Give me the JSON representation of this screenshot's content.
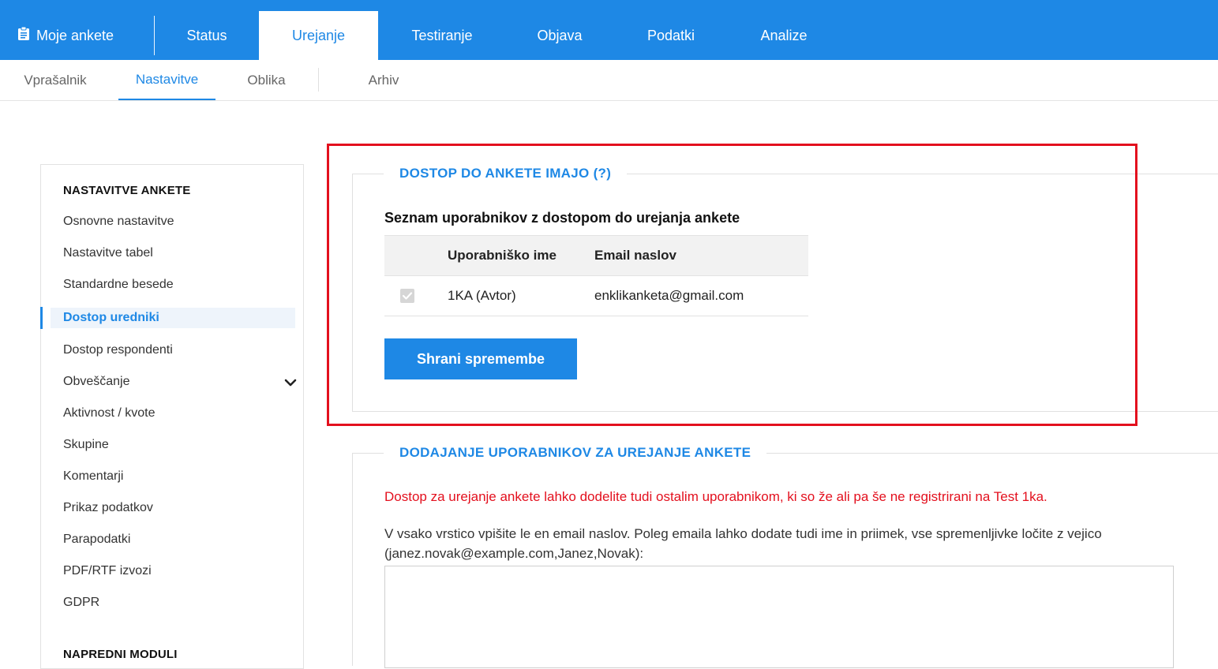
{
  "topnav": {
    "my_surveys": "Moje ankete",
    "items": [
      "Status",
      "Urejanje",
      "Testiranje",
      "Objava",
      "Podatki",
      "Analize"
    ],
    "active": "Urejanje"
  },
  "subnav": {
    "items": [
      "Vprašalnik",
      "Nastavitve",
      "Oblika",
      "Arhiv"
    ],
    "active": "Nastavitve"
  },
  "sidebar": {
    "heading": "NASTAVITVE ANKETE",
    "links": [
      "Osnovne nastavitve",
      "Nastavitve tabel",
      "Standardne besede",
      "Dostop uredniki",
      "Dostop respondenti",
      "Obveščanje",
      "Aktivnost / kvote",
      "Skupine",
      "Komentarji",
      "Prikaz podatkov",
      "Parapodatki",
      "PDF/RTF izvozi",
      "GDPR"
    ],
    "active_link": "Dostop uredniki",
    "heading2": "NAPREDNI MODULI"
  },
  "access": {
    "legend": "DOSTOP DO ANKETE IMAJO (?)",
    "list_title": "Seznam uporabnikov z dostopom do urejanja ankete",
    "columns": [
      "Uporabniško ime",
      "Email naslov"
    ],
    "rows": [
      {
        "username": "1KA (Avtor)",
        "email": "enklikanketa@gmail.com",
        "checked": true
      }
    ],
    "save_button": "Shrani spremembe"
  },
  "add_users": {
    "legend": "DODAJANJE UPORABNIKOV ZA UREJANJE ANKETE",
    "note": "Dostop za urejanje ankete lahko dodelite tudi ostalim uporabnikom, ki so že ali pa še ne registrirani na Test 1ka.",
    "instructions": "V vsako vrstico vpišite le en email naslov. Poleg emaila lahko dodate tudi ime in priimek, vse spremenljivke ločite z vejico (janez.novak@example.com,Janez,Novak):",
    "textarea_value": ""
  },
  "colors": {
    "accent": "#1e88e5",
    "highlight": "#e3101e",
    "note": "#e3101e"
  }
}
